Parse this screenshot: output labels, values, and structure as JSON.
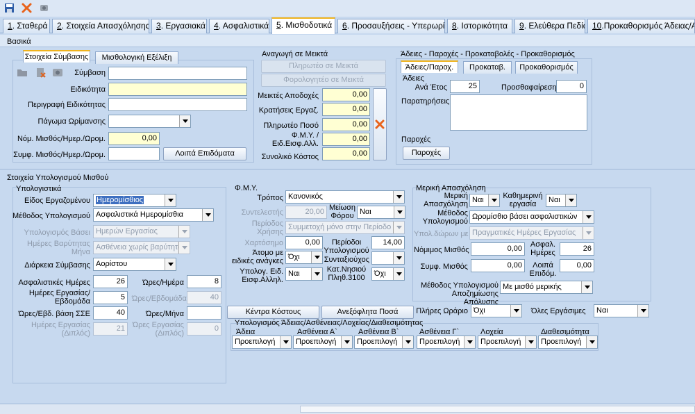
{
  "toolbar": {
    "icons": [
      "save-icon",
      "delete-icon",
      "tools-icon"
    ]
  },
  "tabs": [
    {
      "num": "1",
      "label": ". Σταθερά"
    },
    {
      "num": "2",
      "label": ". Στοιχεία Απασχόλησης"
    },
    {
      "num": "3",
      "label": ". Εργασιακά"
    },
    {
      "num": "4",
      "label": ". Ασφαλιστικά"
    },
    {
      "num": "5",
      "label": ". Μισθοδοτικά"
    },
    {
      "num": "6",
      "label": ". Προσαυξήσεις - Υπερωρίες"
    },
    {
      "num": "8",
      "label": ". Ιστορικότητα"
    },
    {
      "num": "9",
      "label": ". Ελεύθερα Πεδία"
    },
    {
      "num": "10",
      "label": ".Προκαθορισμός Άδειας/Ασθένειας"
    }
  ],
  "basika": "Βασικά",
  "contract": {
    "tab1": "Στοιχεία Σύμβασης",
    "tab2": "Μισθολογική Εξέλιξη",
    "symvasi": "Σύμβαση",
    "eidikotita": "Ειδικότητα",
    "perigrafi": "Περιγραφή Ειδικότητας",
    "pagoma": "Πάγωμα Ωρίμανσης",
    "nom_misthos": "Νόμ. Μισθός/Ημερ./Ωρομ.",
    "nom_value": "0,00",
    "symf_misthos": "Συμφ. Μισθός/Ημερ./Ωρομ.",
    "loipa_btn": "Λοιπά Επιδόματα"
  },
  "anagogi": {
    "title": "Αναγωγή σε Μεικτά",
    "btn1": "Πληρωτέο σε Μεικτά",
    "btn2": "Φορολογητέο σε Μεικτά",
    "rows": [
      {
        "label": "Μεικτές Αποδοχές",
        "value": "0,00"
      },
      {
        "label": "Κρατήσεις Εργαζ.",
        "value": "0,00"
      },
      {
        "label": "Πληρωτέο Ποσό",
        "value": "0,00"
      },
      {
        "label": "Φ.Μ.Υ. / Ειδ.Εισφ.Αλλ.",
        "value": "0,00"
      },
      {
        "label": "Συνολικό Κόστος",
        "value": "0,00"
      }
    ]
  },
  "adeies": {
    "title": "Άδειες - Παροχές - Προκαταβολές - Προκαθορισμός",
    "tab1": "Άδειες/Παροχ.",
    "tab2": "Προκαταβ.",
    "tab3": "Προκαθορισμός",
    "adeies_label": "Άδειες",
    "ana_etos": "Ανά Έτος",
    "ana_etos_value": "25",
    "prosthafairesi": "Προσθαφαίρεση",
    "prosthafairesi_value": "0",
    "paratiriseis": "Παρατηρήσεις",
    "paroxes_label": "Παροχές",
    "paroxes_btn": "Παροχές"
  },
  "calc": {
    "title": "Στοιχεία Υπολογισμού Μισθού",
    "ypologistika": {
      "title": "Υπολογιστικά",
      "eidos": "Είδος Εργαζομένου",
      "eidos_value": "Ημερομίσθιος",
      "methodos": "Μέθοδος Υπολογισμού",
      "methodos_value": "Ασφαλιστικά Ημερομίσθια",
      "vasi": "Υπολογισμός Βάσει",
      "vasi_value": "Ημερών Εργασίας",
      "imeres_vari": "Ημέρες Βαρύτητας Μήνα",
      "imeres_vari_value": "Ασθένεια χωρίς βαρύτητα",
      "diarkeia": "Διάρκεια Σύμβασης",
      "diarkeia_value": "Αορίστου",
      "asfal_imeres": "Ασφαλιστικές Ημέρες",
      "asfal_imeres_value": "26",
      "ores_imera": "Ώρες/Ημέρα",
      "ores_imera_value": "8",
      "imeres_evd": "Ημέρες Εργασίας/Εβδομάδα",
      "imeres_evd_value": "5",
      "ores_evd": "Ώρες/Εβδομάδα",
      "ores_evd_value": "40",
      "ores_evd_sse": "Ώρες/Εβδ. βάση ΣΣΕ",
      "ores_evd_sse_value": "40",
      "ores_mina": "Ώρες/Μήνα",
      "ores_mina_value": "",
      "imeres_diplos": "Ημέρες Εργασίας (Διπλός)",
      "imeres_diplos_value": "21",
      "ores_diplos": "Ώρες Εργασίας (Διπλός)",
      "ores_diplos_value": "0"
    },
    "fmy": {
      "title": "Φ.Μ.Υ.",
      "tropos": "Τρόπος",
      "tropos_value": "Κανονικός",
      "syntelestis": "Συντελεστής",
      "syntelestis_value": "20,00",
      "meiosi": "Μείωση Φόρου",
      "meiosi_value": "Ναι",
      "periodos_xrisis": "Περίοδος Χρήσης",
      "periodos_xrisis_value": "Συμμετοχή μόνο στην Περίοδο Ε",
      "xartosimo": "Χαρτόσημο",
      "xartosimo_value": "0,00",
      "periodoi": "Περίοδοι Υπολογισμού",
      "periodoi_value": "14,00",
      "atomo": "Άτομο με ειδικές ανάγκες",
      "atomo_value": "Όχι",
      "syntaxiouxos": "Συνταξιούχος",
      "syntaxiouxos_value": "",
      "ypolog_eid": "Υπολογ. Ειδ. Εισφ.Αλληλ.",
      "ypolog_eid_value": "Ναι",
      "kat_nisiou": "Κατ.Νησιού Πληθ.3100",
      "kat_nisiou_value": "Όχι",
      "kentra_btn": "Κέντρα Κόστους",
      "anexofl_btn": "Ανεξόφλητα Ποσά"
    },
    "ypol_adeias": {
      "title": "Υπολογισμός Άδειας/Ασθένειας/Λοχείας/Διαθεσιμότητας",
      "cols": [
        {
          "label": "Άδεια",
          "value": "Προεπιλογή"
        },
        {
          "label": "Ασθένεια Α`",
          "value": "Προεπιλογή"
        },
        {
          "label": "Ασθένεια Β`",
          "value": "Προεπιλογή"
        },
        {
          "label": "Ασθένεια Γ`",
          "value": "Προεπιλογή"
        },
        {
          "label": "Λοχεία",
          "value": "Προεπιλογή"
        },
        {
          "label": "Διαθεσιμότητα",
          "value": "Προεπιλογή"
        }
      ]
    },
    "meriki": {
      "title": "Μερική Απασχόληση",
      "meriki_apas": "Μερική Απασχόληση",
      "meriki_apas_value": "Ναι",
      "kathim": "Καθημερινή εργασία",
      "kathim_value": "Ναι",
      "methodos": "Μέθοδος Υπολογισμού",
      "methodos_value": "Ωρομίσθιο βάσει ασφαλιστικών",
      "ypol_doron": "Υπολ.δώρων με",
      "ypol_doron_value": "Πραγματικές Ημέρες Εργασίας",
      "nomimos": "Νόμιμος Μισθός",
      "nomimos_value": "0,00",
      "asfal_imeres": "Ασφαλ. Ημέρες",
      "asfal_imeres_value": "26",
      "symf": "Συμφ. Μισθός",
      "symf_value": "0,00",
      "loipa_epid": "Λοιπά Επιδόμ.",
      "loipa_epid_value": "0,00",
      "methodos_apoz": "Μέθοδος Υπολογισμού Αποζημίωσης Απόλυσης",
      "methodos_apoz_value": "Με μισθό μερικής",
      "pliris": "Πλήρες Ωράριο",
      "pliris_value": "Όχι",
      "oles": "Όλες Εργάσιμες",
      "oles_value": "Ναι"
    }
  }
}
